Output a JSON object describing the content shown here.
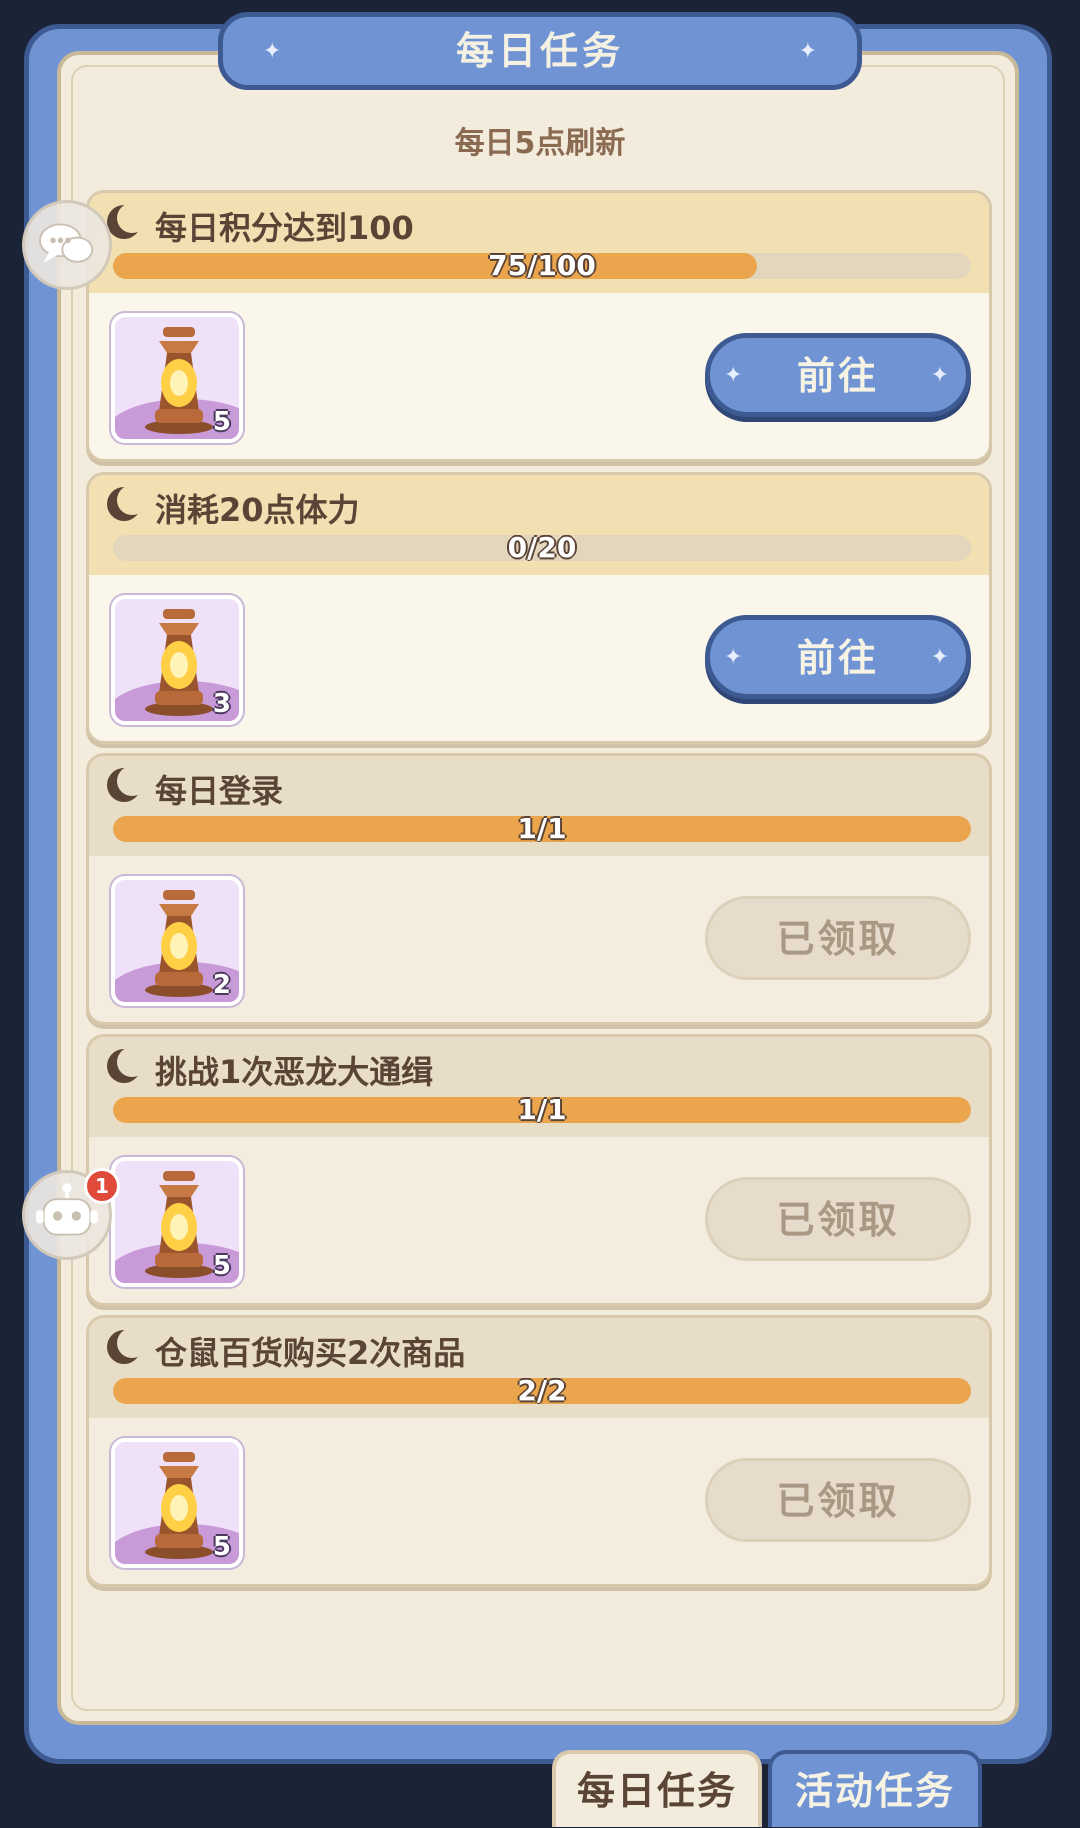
{
  "header": {
    "title": "每日任务",
    "subtitle": "每日5点刷新"
  },
  "tasks": [
    {
      "title": "每日积分达到100",
      "progress_text": "75/100",
      "progress": 0.75,
      "reward_count": "5",
      "button": "前往",
      "state": "active"
    },
    {
      "title": "消耗20点体力",
      "progress_text": "0/20",
      "progress": 0,
      "reward_count": "3",
      "button": "前往",
      "state": "active"
    },
    {
      "title": "每日登录",
      "progress_text": "1/1",
      "progress": 1,
      "reward_count": "2",
      "button": "已领取",
      "state": "claimed"
    },
    {
      "title": "挑战1次恶龙大通缉",
      "progress_text": "1/1",
      "progress": 1,
      "reward_count": "5",
      "button": "已领取",
      "state": "claimed"
    },
    {
      "title": "仓鼠百货购买2次商品",
      "progress_text": "2/2",
      "progress": 1,
      "reward_count": "5",
      "button": "已领取",
      "state": "claimed"
    }
  ],
  "side": {
    "chat_icon": "chat-bubbles-icon",
    "robot_icon": "robot-icon",
    "badge": "1"
  },
  "tabs": {
    "daily": "每日任务",
    "event": "活动任务"
  },
  "colors": {
    "accent": "#6f93d3",
    "progress": "#eba54d",
    "panel": "#f3ecdc"
  }
}
